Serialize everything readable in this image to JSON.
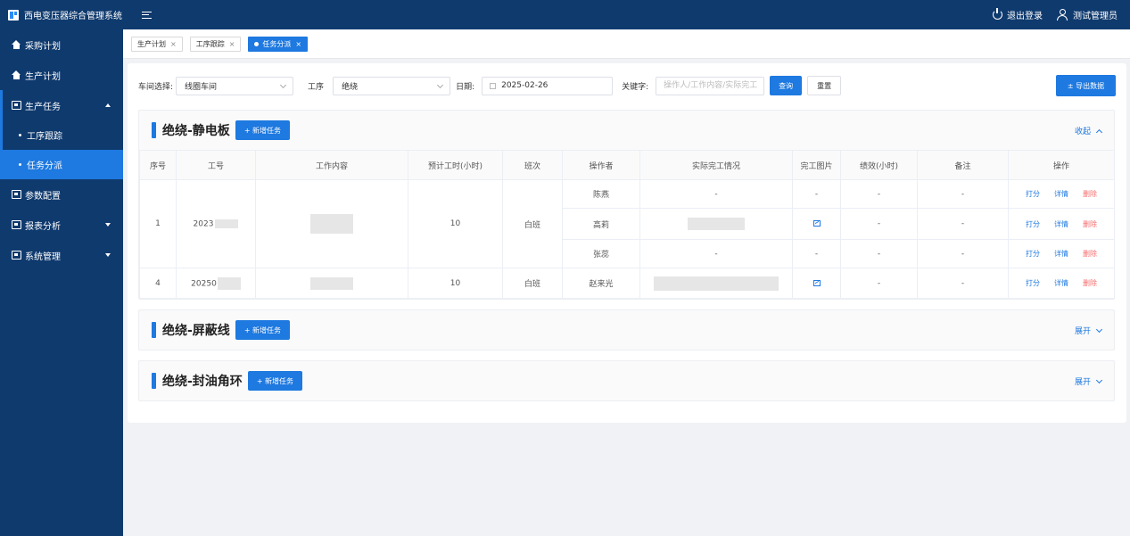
{
  "app": {
    "title": "西电变压器综合管理系统"
  },
  "header": {
    "logout_label": "退出登录",
    "user_name": "测试管理员"
  },
  "sidebar": {
    "items": [
      {
        "label": "采购计划",
        "icon": "home-icon"
      },
      {
        "label": "生产计划",
        "icon": "home-icon"
      },
      {
        "label": "生产任务",
        "icon": "chart-icon",
        "expanded": true,
        "children": [
          {
            "label": "工序跟踪"
          },
          {
            "label": "任务分派",
            "active": true
          }
        ]
      },
      {
        "label": "参数配置",
        "icon": "settings-icon"
      },
      {
        "label": "报表分析",
        "icon": "report-icon"
      },
      {
        "label": "系统管理",
        "icon": "monitor-icon"
      }
    ]
  },
  "tabs": [
    {
      "label": "生产计划"
    },
    {
      "label": "工序跟踪"
    },
    {
      "label": "任务分派",
      "active": true
    }
  ],
  "filters": {
    "workshop_label": "车间选择:",
    "workshop_value": "线圈车间",
    "process_label": "工序",
    "process_value": "绝绕",
    "date_label": "日期:",
    "date_value": "2025-02-26",
    "keyword_label": "关键字:",
    "keyword_placeholder": "操作人/工作内容/实际完工",
    "search_label": "查询",
    "reset_label": "重置",
    "export_label": "± 导出数据"
  },
  "sections": [
    {
      "title": "绝绕-静电板",
      "add_label": "+ 新增任务",
      "toggle_label": "收起",
      "expanded": true
    },
    {
      "title": "绝绕-屏蔽线",
      "add_label": "+ 新增任务",
      "toggle_label": "展开",
      "expanded": false
    },
    {
      "title": "绝绕-封油角环",
      "add_label": "+ 新增任务",
      "toggle_label": "展开",
      "expanded": false
    }
  ],
  "table": {
    "columns": [
      "序号",
      "工号",
      "工作内容",
      "预计工时(小时)",
      "班次",
      "操作者",
      "实际完工情况",
      "完工图片",
      "绩效(小时)",
      "备注",
      "操作"
    ],
    "actions": {
      "score": "打分",
      "detail": "详情",
      "delete": "删除"
    },
    "groups": [
      {
        "index": "1",
        "job_no": "2023",
        "hours": "10",
        "shift": "白班",
        "rows": [
          {
            "operator": "陈燕",
            "actual": "-",
            "image": "-",
            "perf": "-",
            "note": "-"
          },
          {
            "operator": "高莉",
            "actual": "",
            "image": "image-icon",
            "perf": "-",
            "note": "-"
          },
          {
            "operator": "张蕊",
            "actual": "-",
            "image": "-",
            "perf": "-",
            "note": "-"
          }
        ]
      },
      {
        "index": "4",
        "job_no": "20250",
        "hours": "10",
        "shift": "白班",
        "rows": [
          {
            "operator": "赵来光",
            "actual": "",
            "image": "image-icon",
            "perf": "-",
            "note": "-"
          }
        ]
      }
    ]
  }
}
